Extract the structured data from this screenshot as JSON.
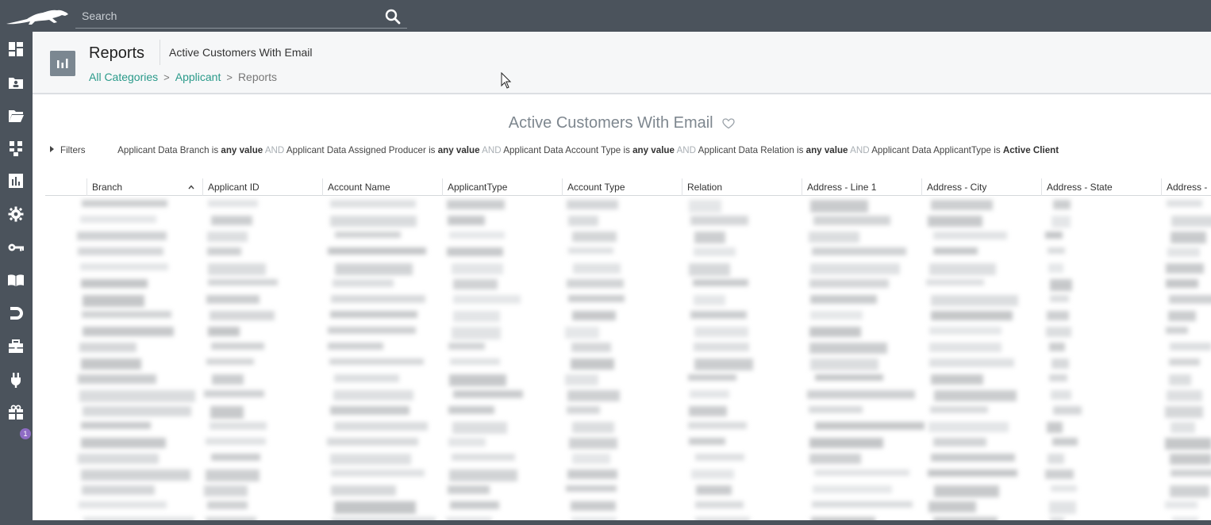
{
  "app": {
    "search_placeholder": "Search"
  },
  "page": {
    "title": "Reports",
    "subtitle": "Active Customers With Email",
    "breadcrumb": [
      "All Categories",
      "Applicant",
      "Reports"
    ]
  },
  "report": {
    "title": "Active Customers With Email",
    "filters_label": "Filters",
    "filters": [
      {
        "field": "Applicant Data Branch",
        "op": "is",
        "value": "any value"
      },
      {
        "field": "Applicant Data Assigned Producer",
        "op": "is",
        "value": "any value"
      },
      {
        "field": "Applicant Data Account Type",
        "op": "is",
        "value": "any value"
      },
      {
        "field": "Applicant Data Relation",
        "op": "is",
        "value": "any value"
      },
      {
        "field": "Applicant Data ApplicantType",
        "op": "is",
        "value": "Active Client"
      }
    ],
    "and_word": "AND",
    "columns": [
      "Branch",
      "Applicant ID",
      "Account Name",
      "ApplicantType",
      "Account Type",
      "Relation",
      "Address - Line 1",
      "Address - City",
      "Address - State",
      "Address -"
    ]
  },
  "sidebar": {
    "icons": [
      "dashboard-icon",
      "contact-card-icon",
      "folder-icon",
      "org-chart-icon",
      "reports-icon",
      "settings-icon",
      "key-icon",
      "book-icon",
      "magnet-icon",
      "briefcase-icon",
      "plug-icon",
      "gift-icon"
    ],
    "badge_count": "1"
  }
}
